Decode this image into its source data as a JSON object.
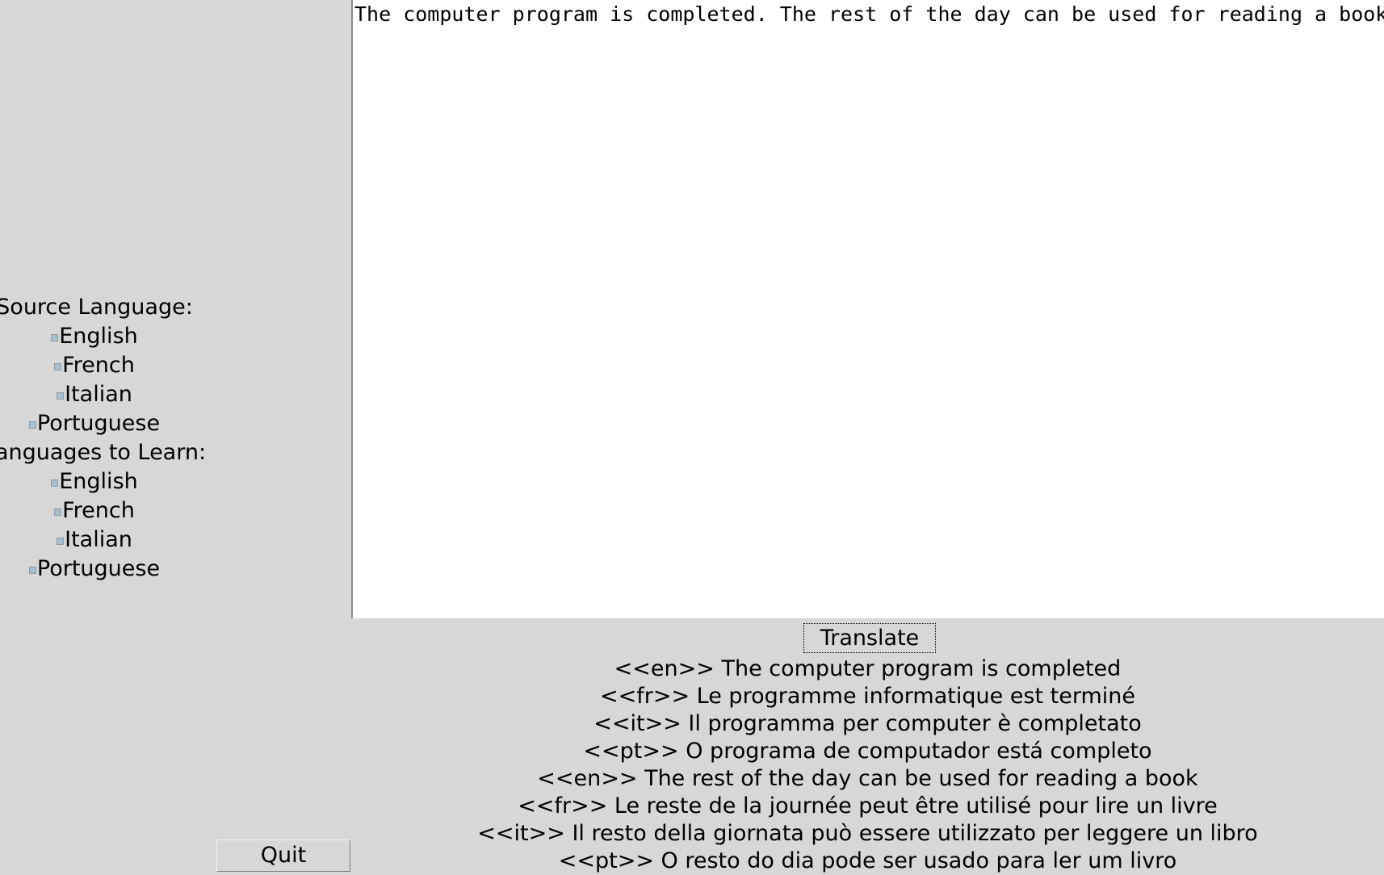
{
  "app": {
    "background_color": "#d7d7d7",
    "text_color": "#000000",
    "radio_marker_color": "#a8bfd0"
  },
  "source_input": {
    "value": "The computer program is completed. The rest of the day can be used for reading a book.",
    "placeholder": ""
  },
  "left_panel": {
    "source_group": {
      "label": "Source Language:",
      "options": [
        {
          "label": "English"
        },
        {
          "label": "French"
        },
        {
          "label": "Italian"
        },
        {
          "label": "Portuguese"
        }
      ]
    },
    "target_group": {
      "label": "Languages to Learn:",
      "options": [
        {
          "label": "English"
        },
        {
          "label": "French"
        },
        {
          "label": "Italian"
        },
        {
          "label": "Portuguese"
        }
      ]
    },
    "quit_label": "Quit"
  },
  "output_panel": {
    "translate_label": "Translate",
    "lines": [
      "<<en>> The computer program is completed",
      "<<fr>> Le programme informatique est terminé",
      "<<it>> Il programma per computer è completato",
      "<<pt>> O programa de computador está completo",
      "<<en>> The rest of the day can be used for reading a book",
      "<<fr>> Le reste de la journée peut être utilisé pour lire un livre",
      "<<it>> Il resto della giornata può essere utilizzato per leggere un libro",
      "<<pt>> O resto do dia pode ser usado para ler um livro"
    ]
  }
}
